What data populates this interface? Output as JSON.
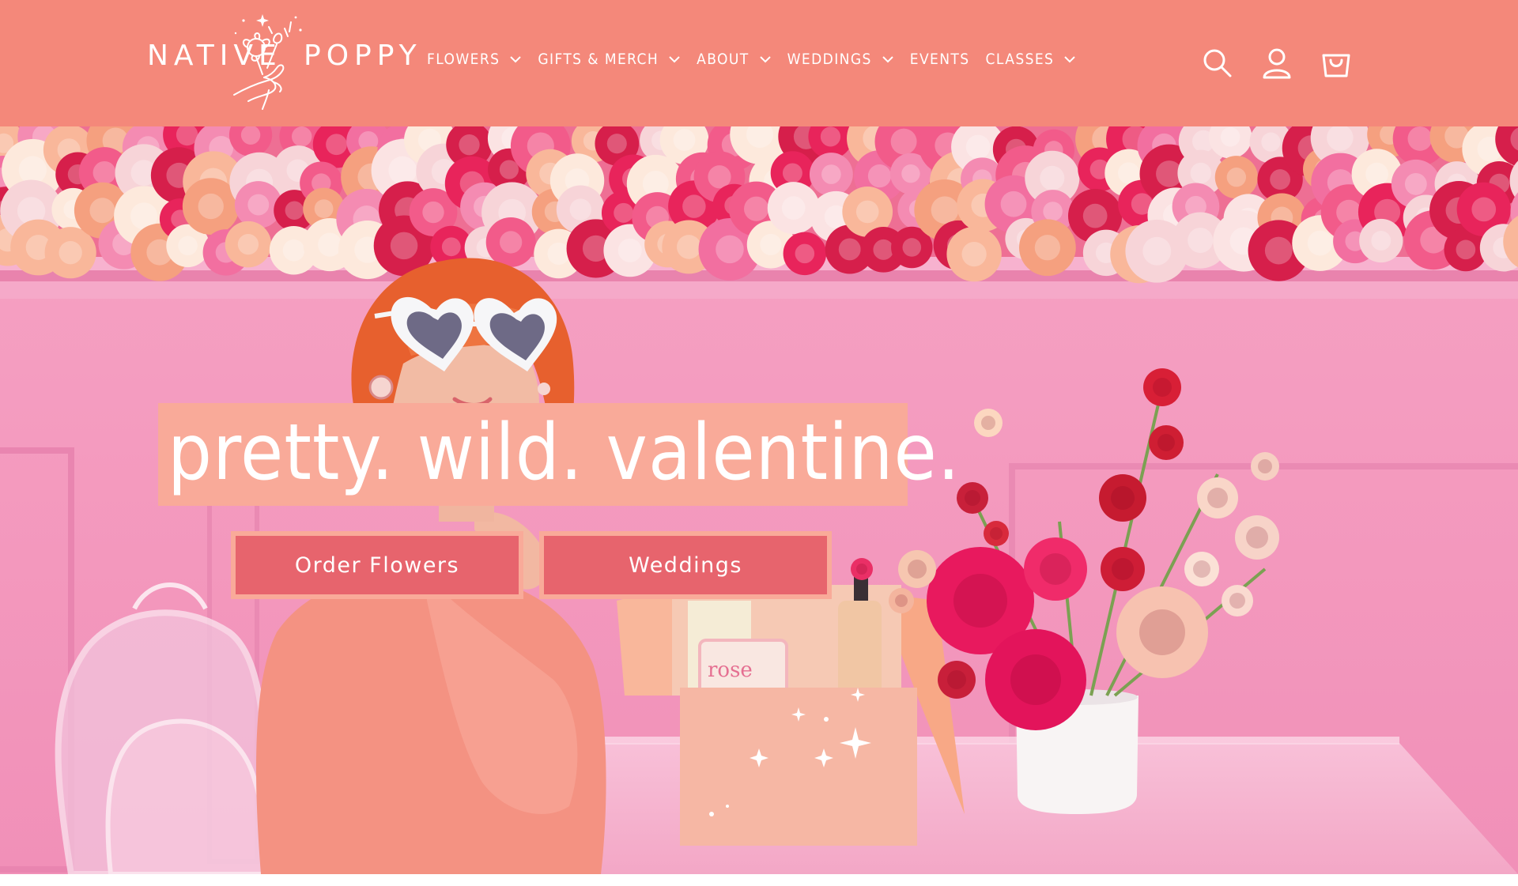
{
  "brand": {
    "name_left": "NATIVE",
    "name_right": "POPPY"
  },
  "nav": {
    "items": [
      {
        "label": "FLOWERS",
        "has_dropdown": true
      },
      {
        "label": "GIFTS & MERCH",
        "has_dropdown": true
      },
      {
        "label": "ABOUT",
        "has_dropdown": true
      },
      {
        "label": "WEDDINGS",
        "has_dropdown": true
      },
      {
        "label": "EVENTS",
        "has_dropdown": false
      },
      {
        "label": "CLASSES",
        "has_dropdown": true
      }
    ]
  },
  "header_icons": [
    "search-icon",
    "account-icon",
    "cart-icon"
  ],
  "hero": {
    "headline": "pretty. wild. valentine.",
    "buttons": {
      "primary": "Order Flowers",
      "secondary": "Weddings"
    },
    "box_label": "rose"
  },
  "colors": {
    "header_bg": "#f4887a",
    "headline_bg": "#f9aa99",
    "button_bg": "#e7646d",
    "wall_pink": "#f49bbf"
  }
}
